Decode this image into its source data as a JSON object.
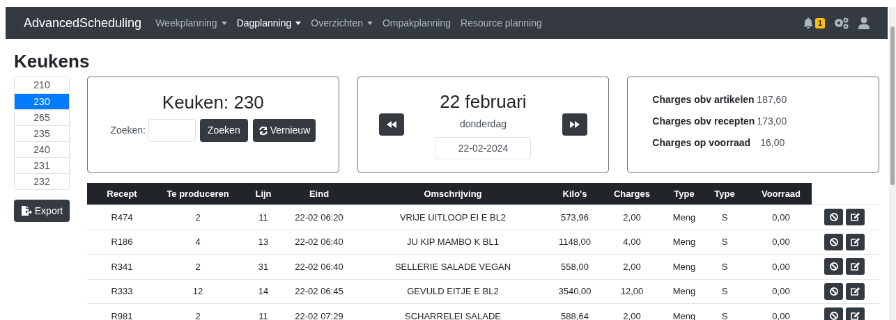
{
  "navbar": {
    "brand": "AdvancedScheduling",
    "items": [
      {
        "label": "Weekplanning",
        "dropdown": true,
        "selected": false
      },
      {
        "label": "Dagplanning",
        "dropdown": true,
        "selected": true
      },
      {
        "label": "Overzichten",
        "dropdown": true,
        "selected": false
      },
      {
        "label": "Ompakplanning",
        "dropdown": false,
        "selected": false
      },
      {
        "label": "Resource planning",
        "dropdown": false,
        "selected": false
      }
    ],
    "notification_count": "1"
  },
  "page_title": "Keukens",
  "kitchens": [
    {
      "label": "210",
      "selected": false
    },
    {
      "label": "230",
      "selected": true
    },
    {
      "label": "265",
      "selected": false
    },
    {
      "label": "235",
      "selected": false
    },
    {
      "label": "240",
      "selected": false
    },
    {
      "label": "231",
      "selected": false
    },
    {
      "label": "232",
      "selected": false
    }
  ],
  "export_button": "Export",
  "kitchen_card": {
    "title": "Keuken: 230",
    "search_label": "Zoeken:",
    "search_button": "Zoeken",
    "refresh_button": "Vernieuw"
  },
  "date_card": {
    "title": "22 februari",
    "weekday": "donderdag",
    "date": "22-02-2024"
  },
  "charges_card": [
    {
      "label": "Charges obv artikelen",
      "value": "187,60"
    },
    {
      "label": "Charges obv recepten",
      "value": "173,00"
    },
    {
      "label": "Charges op voorraad",
      "value": "16,00"
    }
  ],
  "table": {
    "columns": [
      "Recept",
      "Te produceren",
      "Lijn",
      "Eind",
      "Omschrijving",
      "Kilo's",
      "Charges",
      "Type",
      "Type",
      "Voorraad"
    ],
    "rows": [
      [
        "R474",
        "2",
        "11",
        "22-02 06:20",
        "VRIJE UITLOOP EI E BL2",
        "573,96",
        "2,00",
        "Meng",
        "S",
        "0,00"
      ],
      [
        "R186",
        "4",
        "13",
        "22-02 06:40",
        "JU KIP MAMBO K BL1",
        "1148,00",
        "4,00",
        "Meng",
        "S",
        "0,00"
      ],
      [
        "R341",
        "2",
        "31",
        "22-02 06:40",
        "SELLERIE SALADE VEGAN",
        "558,00",
        "2,00",
        "Meng",
        "S",
        "0,00"
      ],
      [
        "R333",
        "12",
        "14",
        "22-02 06:45",
        "GEVULD EITJE E BL2",
        "3540,00",
        "12,00",
        "Meng",
        "S",
        "0,00"
      ],
      [
        "R981",
        "2",
        "11",
        "22-02 07:29",
        "SCHARRELEI SALADE",
        "588,64",
        "2,00",
        "Meng",
        "S",
        "0,00"
      ]
    ]
  }
}
